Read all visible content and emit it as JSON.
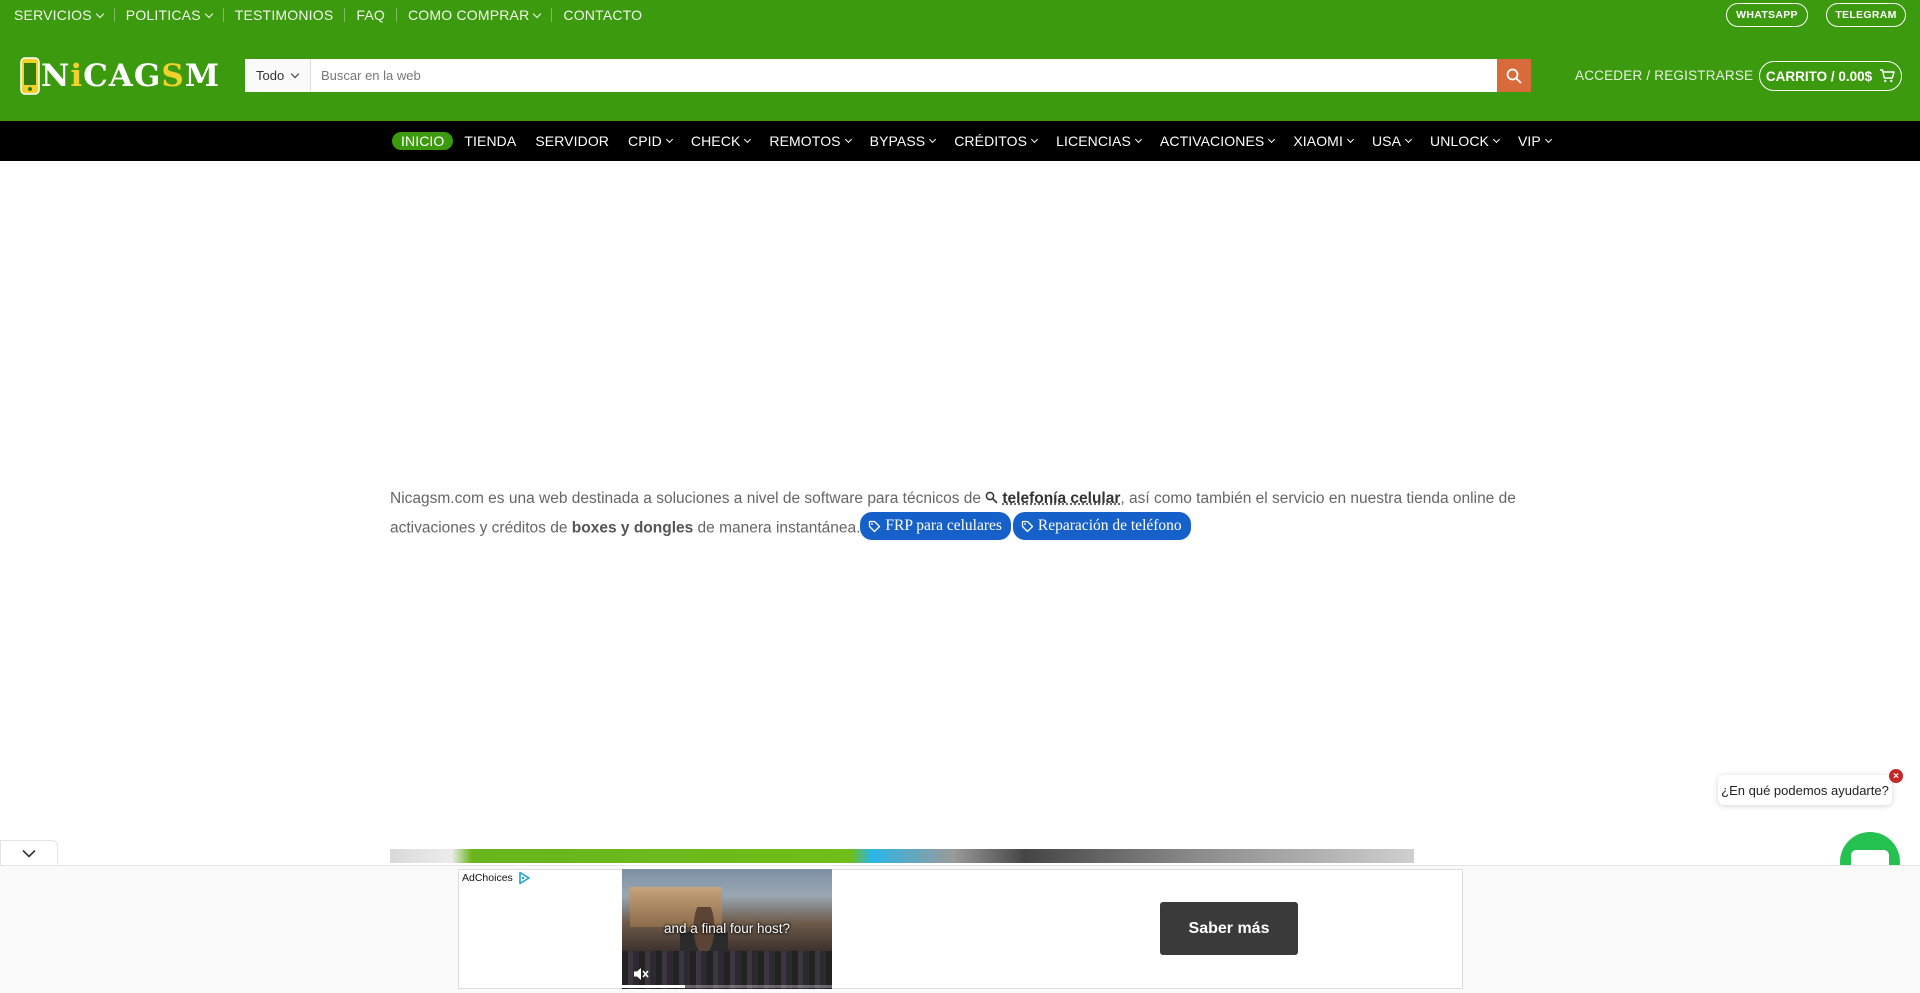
{
  "topbar": {
    "nav": [
      {
        "label": "SERVICIOS",
        "dropdown": true
      },
      {
        "label": "POLITICAS",
        "dropdown": true
      },
      {
        "label": "TESTIMONIOS",
        "dropdown": false
      },
      {
        "label": "FAQ",
        "dropdown": false
      },
      {
        "label": "COMO COMPRAR",
        "dropdown": true
      },
      {
        "label": "CONTACTO",
        "dropdown": false
      }
    ],
    "whatsapp": "WHATSAPP",
    "telegram": "TELEGRAM"
  },
  "header": {
    "logo_text_1": "N",
    "logo_text_2": "i",
    "logo_text_3": "CAG",
    "logo_text_4": "S",
    "logo_text_5": "M",
    "search_category": "Todo",
    "search_placeholder": "Buscar en la web",
    "account_link": "ACCEDER / REGISTRARSE",
    "cart_label": "CARRITO / 0.00$"
  },
  "mainnav": [
    {
      "label": "INICIO",
      "dropdown": false,
      "active": true
    },
    {
      "label": "TIENDA",
      "dropdown": false
    },
    {
      "label": "SERVIDOR",
      "dropdown": false
    },
    {
      "label": "CPID",
      "dropdown": true
    },
    {
      "label": "CHECK",
      "dropdown": true
    },
    {
      "label": "REMOTOS",
      "dropdown": true
    },
    {
      "label": "BYPASS",
      "dropdown": true
    },
    {
      "label": "CRÉDITOS",
      "dropdown": true
    },
    {
      "label": "LICENCIAS",
      "dropdown": true
    },
    {
      "label": "ACTIVACIONES",
      "dropdown": true
    },
    {
      "label": "XIAOMI",
      "dropdown": true
    },
    {
      "label": "USA",
      "dropdown": true
    },
    {
      "label": "UNLOCK",
      "dropdown": true
    },
    {
      "label": "VIP",
      "dropdown": true
    }
  ],
  "intro": {
    "part1": "Nicagsm.com es una web destinada a soluciones a nivel de software para técnicos de ",
    "keyword": "telefonía celular",
    "part2": ", así como también el servicio en nuestra tienda online de activaciones y créditos de ",
    "bold": "boxes y dongles",
    "part3": " de manera instantánea.",
    "tag1": "FRP para celulares",
    "tag2": "Reparación de teléfono"
  },
  "chat": {
    "prompt": "¿En qué podemos ayudarte?",
    "close": "×"
  },
  "ad": {
    "adchoices": "AdChoices",
    "video_caption": "and a final four host?",
    "cta": "Saber más",
    "video_progress": 0.3
  },
  "colors": {
    "brand_green": "#3c9a0e",
    "nav_black": "#000000",
    "search_button": "#d96b3b",
    "tag_blue": "#1661c9",
    "whatsapp_green": "#25c252"
  }
}
